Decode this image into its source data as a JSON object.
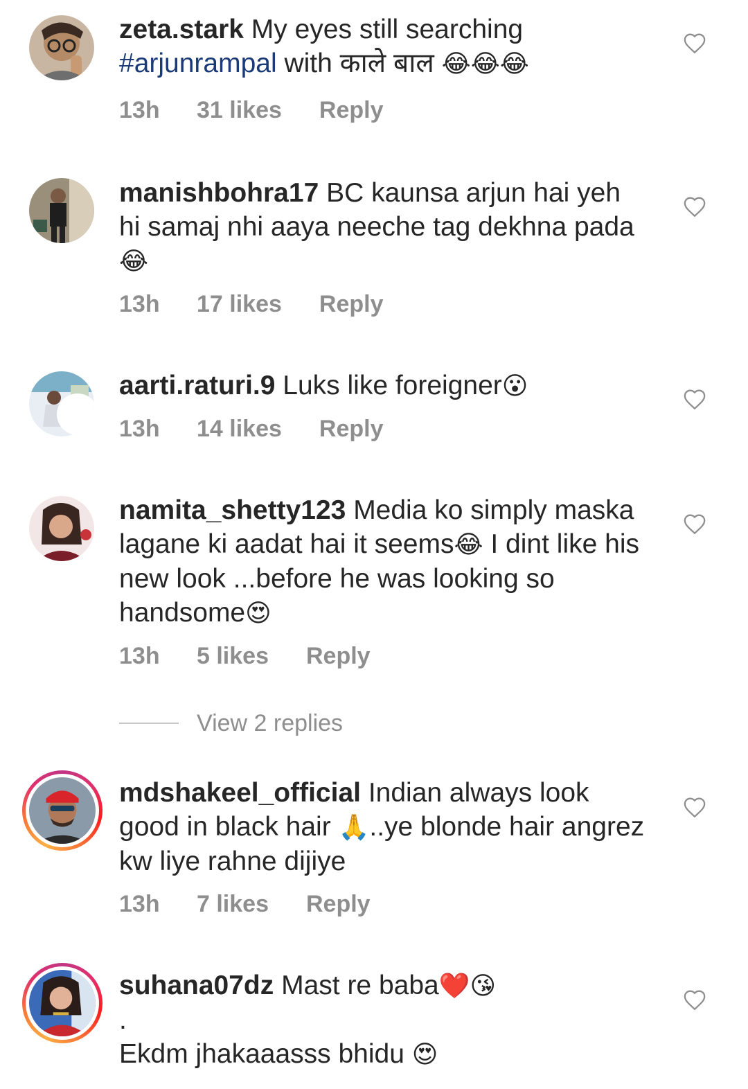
{
  "comments": [
    {
      "username": "zeta.stark",
      "text_a": "My eyes still searching",
      "hashtag": "#arjunrampal",
      "text_b": "with  काले बाल",
      "emoji": "😂😂😂",
      "time": "13h",
      "likes": "31 likes",
      "reply": "Reply"
    },
    {
      "username": "manishbohra17",
      "text": "BC kaunsa arjun hai yeh hi samaj nhi aaya neeche tag dekhna pada",
      "emoji": "😂",
      "time": "13h",
      "likes": "17 likes",
      "reply": "Reply"
    },
    {
      "username": "aarti.raturi.9",
      "text": "Luks like foreigner",
      "emoji": "😮",
      "time": "13h",
      "likes": "14 likes",
      "reply": "Reply"
    },
    {
      "username": "namita_shetty123",
      "text_a": "Media ko simply maska lagane ki aadat hai it seems",
      "emoji_a": "😂",
      "text_b": "I dint like  his  new look ...before he was looking so handsome",
      "emoji_b": "😍",
      "time": "13h",
      "likes": "5 likes",
      "reply": "Reply"
    },
    {
      "username": "mdshakeel_official",
      "text_a": "Indian always look good in black hair",
      "emoji": "🙏",
      "text_b": "..ye blonde hair angrez kw liye rahne dijiye",
      "time": "13h",
      "likes": "7 likes",
      "reply": "Reply"
    },
    {
      "username": "suhana07dz",
      "text_a": "Mast re baba",
      "emoji_a": "❤️😘",
      "dot": ".",
      "text_b": "Ekdm jhakaaasss bhidu",
      "emoji_b": "😍"
    }
  ],
  "view_replies": "View 2 replies",
  "icons": {
    "like": "heart-outline-icon"
  },
  "colors": {
    "hashtag": "#1a3a78",
    "meta": "#8e8e8e",
    "text": "#262626"
  }
}
